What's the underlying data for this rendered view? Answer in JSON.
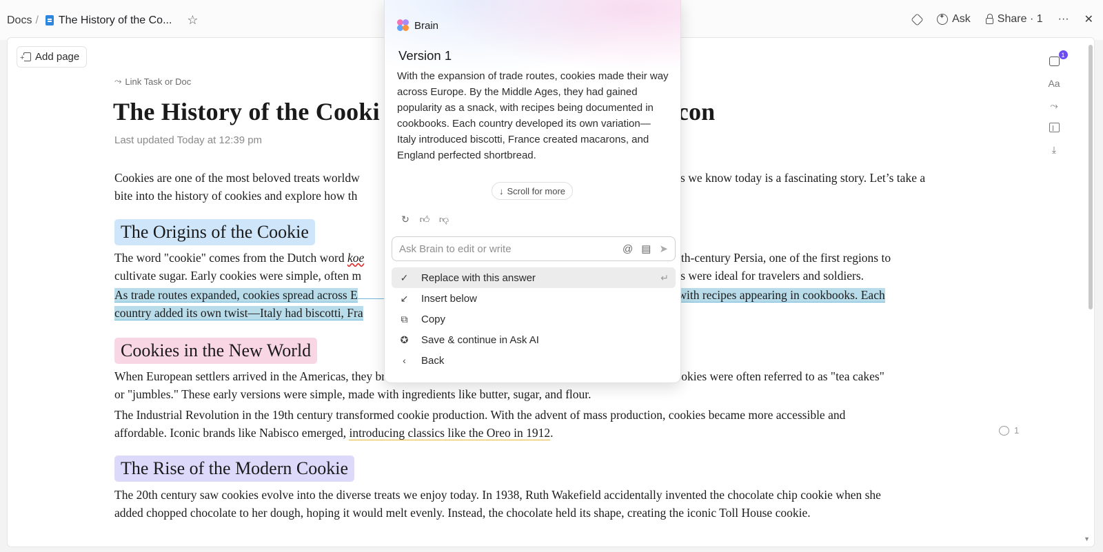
{
  "topbar": {
    "breadcrumb_root": "Docs",
    "breadcrumb_sep": "/",
    "doc_title": "The History of the Co...",
    "ask_label": "Ask",
    "share_label": "Share · 1",
    "more_label": "···",
    "close_label": "✕"
  },
  "sidebar": {
    "add_page_label": "Add page"
  },
  "doc": {
    "link_task_label": "Link Task or Doc",
    "title_left": "The History of the Cooki",
    "title_right": "con",
    "last_updated": "Last updated Today at 12:39 pm",
    "intro_a": "Cookies are one of the most beloved treats worldw",
    "intro_b": "g icons we know today is a fascinating story. Let’s take a",
    "intro_c": "bite into the history of cookies and explore how th",
    "h_origins": "The Origins of the Cookie",
    "origins_a": "The word \"cookie\" comes from the Dutch word ",
    "origins_koe": "koe",
    "origins_b": "ck to 7th-century Persia, one of the first regions to",
    "origins_c": "cultivate sugar. Early cookies were simple, often m",
    "origins_d": "treats were ideal for travelers and soldiers.",
    "trade_a": "As trade routes expanded, cookies spread across E",
    "trade_b": "snack, with recipes appearing in cookbooks. Each",
    "trade_c": "country added its own twist—Italy had biscotti, Fra",
    "h_newworld": "Cookies in the New World",
    "nw_a": "When European settlers arrived in the Americas, t",
    "nw_b": "hey brought their cookie recipes with them. In colonial America, cookies were often referred to as \"tea cakes\"",
    "nw_c": "or \"jumbles.\" These early versions were simple, made with ingredients like butter, sugar, and flour.",
    "ind_a": "The Industrial Revolution in the 19th century transformed cookie production. With the advent of mass production, cookies became more accessible and",
    "ind_b": "affordable. Iconic brands like Nabisco emerged, ",
    "ind_link": "introducing classics like the Oreo in 1912",
    "ind_end": ".",
    "h_modern": "The Rise of the Modern Cookie",
    "mod_a": "The 20th century saw cookies evolve into the diverse treats we enjoy today. In 1938, Ruth Wakefield accidentally invented the chocolate chip cookie when she",
    "mod_b": "added chopped chocolate to her dough, hoping it would melt evenly. Instead, the chocolate held its shape, creating the iconic Toll House cookie.",
    "comment_count": "1"
  },
  "rail": {
    "comments_badge": "1",
    "font_label": "Aa"
  },
  "brain": {
    "name": "Brain",
    "version_title": "Version 1",
    "answer": "With the expansion of trade routes, cookies made their way across Europe. By the Middle Ages, they had gained popularity as a snack, with recipes being documented in cookbooks. Each country developed its own variation—Italy introduced biscotti, France created macarons, and England perfected shortbread.",
    "scroll_more": "Scroll for more",
    "ask_placeholder": "Ask Brain to edit or write",
    "menu": [
      {
        "icon": "✓",
        "label": "Replace with this answer",
        "kbd": "↵"
      },
      {
        "icon": "↙",
        "label": "Insert below"
      },
      {
        "icon": "⧉",
        "label": "Copy"
      },
      {
        "icon": "✪",
        "label": "Save & continue in Ask AI"
      },
      {
        "icon": "‹",
        "label": "Back"
      }
    ]
  },
  "colors": {
    "accent": "#6c4bf4",
    "selection_highlight": "#b9dcea",
    "heading_blue": "#cfe6fa",
    "heading_pink": "#f9d6e4",
    "heading_purple": "#ddd9fb"
  }
}
